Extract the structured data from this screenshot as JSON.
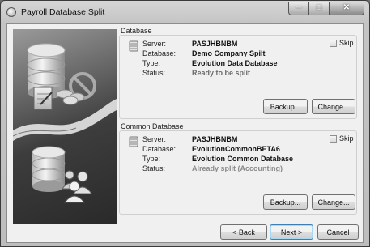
{
  "window": {
    "title": "Payroll Database Split"
  },
  "database": {
    "group_title": "Database",
    "server_label": "Server:",
    "server": "PASJHBNBM",
    "database_label": "Database:",
    "database": "Demo Company Spilt",
    "type_label": "Type:",
    "type": "Evolution Data Database",
    "status_label": "Status:",
    "status": "Ready to be split",
    "skip_label": "Skip",
    "skip_checked": false,
    "backup_label": "Backup...",
    "change_label": "Change..."
  },
  "common_database": {
    "group_title": "Common Database",
    "server_label": "Server:",
    "server": "PASJHBNBM",
    "database_label": "Database:",
    "database": "EvolutionCommonBETA6",
    "type_label": "Type:",
    "type": "Evolution Common Database",
    "status_label": "Status:",
    "status": "Already split (Accounting)",
    "skip_label": "Skip",
    "skip_checked": false,
    "backup_label": "Backup...",
    "change_label": "Change..."
  },
  "footer": {
    "back_label": "< Back",
    "next_label": "Next >",
    "cancel_label": "Cancel"
  },
  "colors": {
    "status_ready": "#6b6b6b",
    "status_done": "#8a8a8a"
  }
}
